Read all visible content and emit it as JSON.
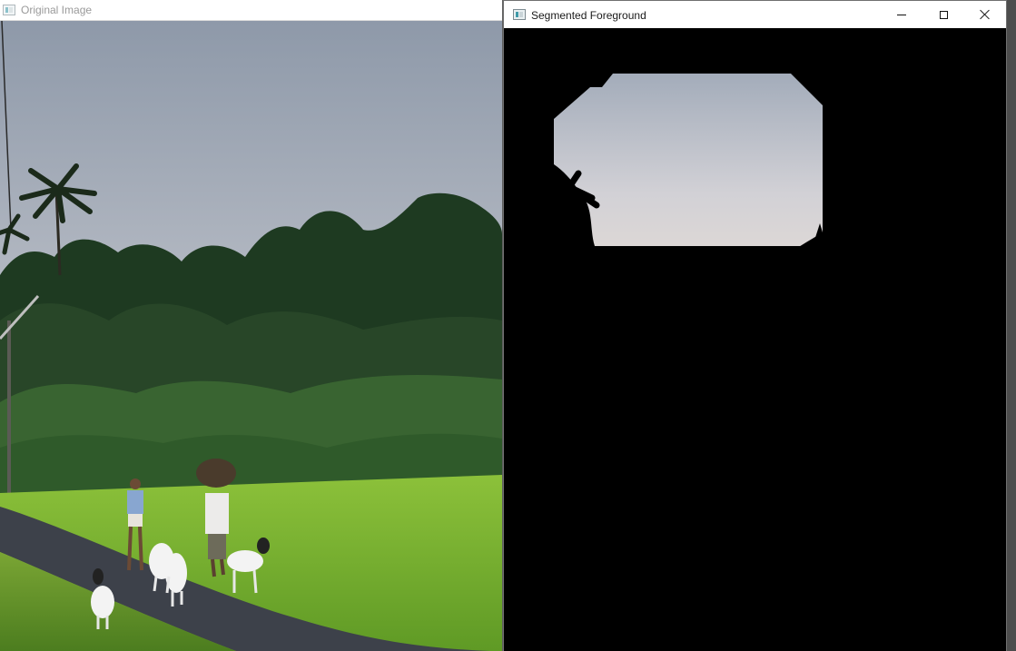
{
  "windows": {
    "original": {
      "title": "Original Image",
      "image": "photo of a rural road with goats, people walking, palm trees and paddy field"
    },
    "segmented": {
      "title": "Segmented Foreground",
      "image": "segmentation output: sky region above tree line, rest masked black",
      "controls": {
        "minimize": "minimize-icon",
        "maximize": "maximize-icon",
        "close": "close-icon"
      }
    }
  },
  "colors": {
    "sky_top": "#9fa8b6",
    "sky_bottom": "#d9d6d8",
    "trees": "#1f3a22",
    "grass": "#7fb135",
    "road": "#3c4048",
    "mask": "#000000"
  }
}
